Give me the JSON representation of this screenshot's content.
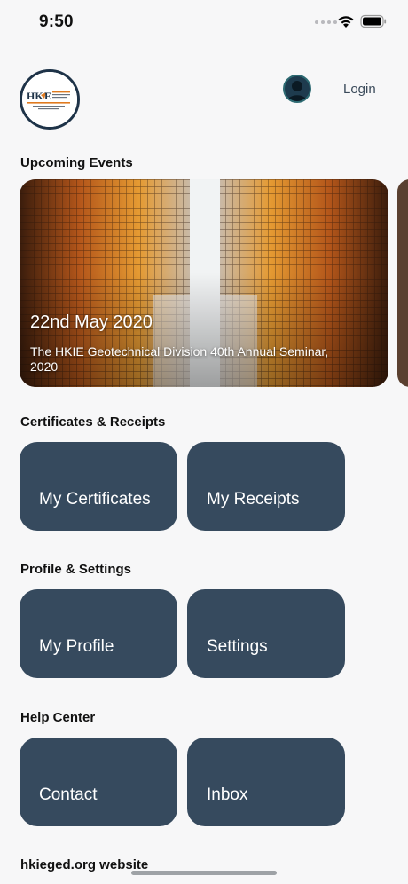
{
  "status_bar": {
    "time": "9:50"
  },
  "header": {
    "logo_text": "HKIE",
    "login_label": "Login"
  },
  "sections": {
    "upcoming_events": "Upcoming Events",
    "certificates": "Certificates & Receipts",
    "profile": "Profile & Settings",
    "help": "Help Center",
    "website": "hkieged.org website"
  },
  "event": {
    "date": "22nd May 2020",
    "title": "The HKIE Geotechnical Division 40th Annual Seminar, 2020"
  },
  "tiles": {
    "my_certificates": "My Certificates",
    "my_receipts": "My Receipts",
    "my_profile": "My Profile",
    "settings": "Settings",
    "contact": "Contact",
    "inbox": "Inbox"
  },
  "colors": {
    "tile_bg": "#364a5e",
    "logo_ring": "#1e3348",
    "logo_accent": "#e07a1f"
  },
  "icons": {
    "wifi": "wifi-icon",
    "battery": "battery-icon",
    "avatar": "user-avatar-icon"
  }
}
